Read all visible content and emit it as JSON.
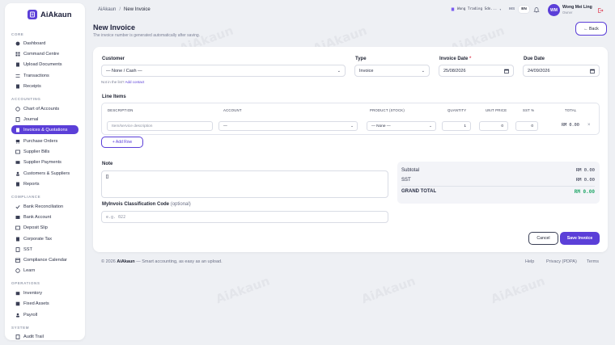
{
  "app": {
    "name": "AiAkaun",
    "watermark": "AiAkaun"
  },
  "topbar": {
    "breadcrumb_root": "AiAkaun",
    "breadcrumb_sep": "/",
    "breadcrumb_current": "New Invoice",
    "company": "Wong Trading Sdn...",
    "lang_ms": "MS",
    "lang_en": "EN",
    "user_initials": "WM",
    "user_name": "Wong Mei Ling",
    "user_role": "Owner"
  },
  "sidebar": {
    "sections": [
      "CORE",
      "ACCOUNTING",
      "COMPLIANCE",
      "OPERATIONS",
      "SYSTEM"
    ],
    "items": [
      {
        "label": "Dashboard",
        "icon": "dashboard-icon"
      },
      {
        "label": "Command Centre",
        "icon": "grid-icon"
      },
      {
        "label": "Upload Documents",
        "icon": "upload-icon"
      },
      {
        "label": "Transactions",
        "icon": "transactions-icon"
      },
      {
        "label": "Receipts",
        "icon": "receipt-icon"
      },
      {
        "label": "Chart of Accounts",
        "icon": "chart-icon"
      },
      {
        "label": "Journal",
        "icon": "journal-icon"
      },
      {
        "label": "Invoices & Quotations",
        "icon": "invoice-icon",
        "active": true
      },
      {
        "label": "Purchase Orders",
        "icon": "cart-icon"
      },
      {
        "label": "Supplier Bills",
        "icon": "bill-icon"
      },
      {
        "label": "Supplier Payments",
        "icon": "card-icon"
      },
      {
        "label": "Customers & Suppliers",
        "icon": "people-icon"
      },
      {
        "label": "Reports",
        "icon": "report-icon"
      },
      {
        "label": "Bank Reconciliation",
        "icon": "check-icon"
      },
      {
        "label": "Bank Account",
        "icon": "bank-icon"
      },
      {
        "label": "Deposit Slip",
        "icon": "slip-icon"
      },
      {
        "label": "Corporate Tax",
        "icon": "tax-icon"
      },
      {
        "label": "SST",
        "icon": "sst-icon"
      },
      {
        "label": "Compliance Calendar",
        "icon": "calendar-icon"
      },
      {
        "label": "Learn",
        "icon": "learn-icon"
      },
      {
        "label": "Inventory",
        "icon": "inventory-icon"
      },
      {
        "label": "Fixed Assets",
        "icon": "assets-icon"
      },
      {
        "label": "Payroll",
        "icon": "payroll-icon"
      },
      {
        "label": "Audit Trail",
        "icon": "audit-icon"
      }
    ]
  },
  "page": {
    "title": "New Invoice",
    "subtitle": "The invoice number is generated automatically after saving.",
    "back_label": "← Back"
  },
  "form": {
    "customer_label": "Customer",
    "customer_value": "— None / Cash —",
    "customer_hint": "Not in the list?",
    "customer_hint_link": "Add contact",
    "type_label": "Type",
    "type_value": "Invoice",
    "invoice_date_label": "Invoice Date",
    "invoice_date_required": "*",
    "invoice_date_value": "25/08/2026",
    "due_date_label": "Due Date",
    "due_date_value": "24/09/2026",
    "line_items_label": "Line Items",
    "columns": [
      "DESCRIPTION",
      "ACCOUNT",
      "PRODUCT (STOCK)",
      "QUANTITY",
      "UNIT PRICE",
      "SST %",
      "TOTAL"
    ],
    "row": {
      "description_placeholder": "Item/service description",
      "account_value": "—",
      "product_value": "— None —",
      "quantity": "1",
      "unit_price": "0",
      "sst": "0",
      "total": "RM 0.00",
      "remove": "×"
    },
    "add_row_label": "+ Add Row",
    "note_label": "Note",
    "note_value": "[]",
    "myinvois_label": "MyInvois Classification Code",
    "myinvois_optional": "(optional)",
    "myinvois_placeholder": "e.g. 022"
  },
  "summary": {
    "subtotal_label": "Subtotal",
    "subtotal_value": "RM 0.00",
    "sst_label": "SST",
    "sst_value": "RM 0.00",
    "grand_label": "GRAND TOTAL",
    "grand_value": "RM 0.00"
  },
  "actions": {
    "cancel": "Cancel",
    "save": "Save Invoice"
  },
  "footer": {
    "copyright": "© 2026",
    "brand": "AiAkaun",
    "tagline": "— Smart accounting, as easy as an upload.",
    "links": [
      "Help",
      "Privacy (PDPA)",
      "Terms"
    ]
  },
  "colors": {
    "accent": "#5b3fd8",
    "success": "#24a86a",
    "danger": "#e04a5f"
  }
}
